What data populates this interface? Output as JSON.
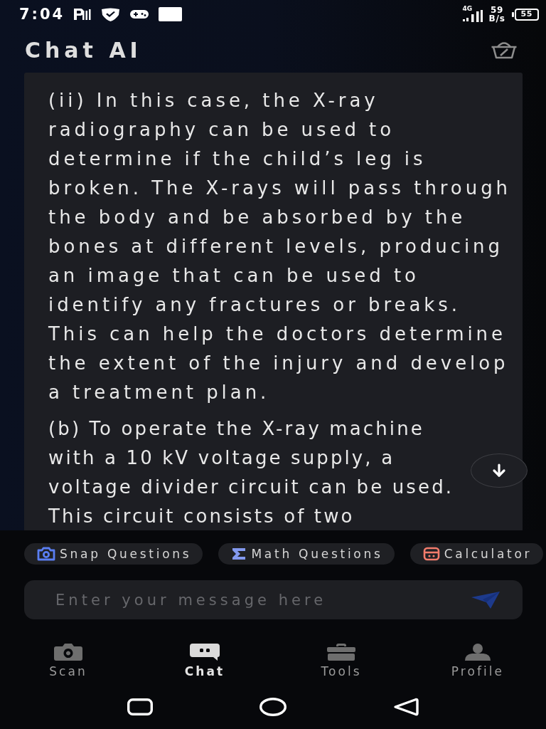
{
  "status_bar": {
    "time": "7:04",
    "network_type": "4G",
    "speed": "59",
    "speed_unit": "B/s",
    "battery": "55"
  },
  "header": {
    "title": "Chat AI"
  },
  "message": {
    "paragraphs": [
      "(ii) In this case, the X-ray radiography can be used to determine if the child’s leg is broken. The X-rays will pass through the body and be absorbed by the bones at different levels, producing an image that can be used to identify any fractures or breaks. This can help the doctors determine the extent of the injury and develop a treatment plan.",
      "(b) To operate the X-ray machine with a 10 kV voltage supply, a voltage divider circuit can be used. This circuit consists of two"
    ]
  },
  "suggestions": [
    {
      "label": "Snap Questions",
      "kind": "camera"
    },
    {
      "label": "Math Questions",
      "kind": "sigma"
    },
    {
      "label": "Calculator",
      "kind": "calculator"
    }
  ],
  "composer": {
    "placeholder": "Enter your message here"
  },
  "nav": [
    {
      "label": "Scan",
      "kind": "camera",
      "selected": false
    },
    {
      "label": "Chat",
      "kind": "chat",
      "selected": true
    },
    {
      "label": "Tools",
      "kind": "toolbox",
      "selected": false
    },
    {
      "label": "Profile",
      "kind": "person",
      "selected": false
    }
  ]
}
